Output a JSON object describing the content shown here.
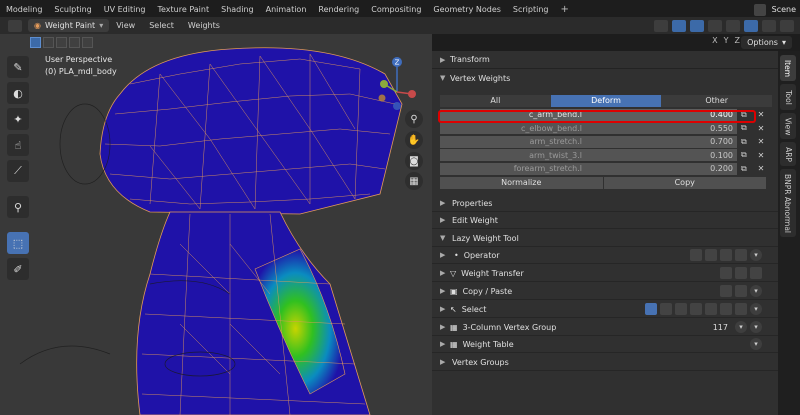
{
  "workspace_tabs": [
    "Modeling",
    "Sculpting",
    "UV Editing",
    "Texture Paint",
    "Shading",
    "Animation",
    "Rendering",
    "Compositing",
    "Geometry Nodes",
    "Scripting"
  ],
  "add_tab": "+",
  "scene_name": "Scene",
  "mode": "Weight Paint",
  "menus": [
    "View",
    "Select",
    "Weights"
  ],
  "axes": [
    "X",
    "Y",
    "Z"
  ],
  "options_label": "Options",
  "viewport": {
    "perspective": "User Perspective",
    "object": "(0) PLA_mdl_body"
  },
  "gizmo_axis": "Z",
  "panel": {
    "transform_label": "Transform",
    "vertex_weights_label": "Vertex Weights",
    "tabs": [
      "All",
      "Deform",
      "Other"
    ],
    "active_tab": "Deform",
    "weights": [
      {
        "name": "c_arm_bend.l",
        "value": "0.400",
        "active": true
      },
      {
        "name": "c_elbow_bend.l",
        "value": "0.550",
        "active": false
      },
      {
        "name": "arm_stretch.l",
        "value": "0.700",
        "active": false
      },
      {
        "name": "arm_twist_3.l",
        "value": "0.100",
        "active": false
      },
      {
        "name": "forearm_stretch.l",
        "value": "0.200",
        "active": false
      }
    ],
    "normalize_label": "Normalize",
    "copy_label": "Copy",
    "sections": {
      "properties": "Properties",
      "edit_weight": "Edit Weight",
      "lazy_weight_tool": "Lazy Weight Tool",
      "operator": "Operator",
      "weight_transfer": "Weight Transfer",
      "copy_paste": "Copy / Paste",
      "select": "Select",
      "three_col_vg": "3-Column Vertex Group",
      "three_col_count": "117",
      "weight_table": "Weight Table",
      "vertex_groups": "Vertex Groups"
    }
  },
  "side_tabs": [
    "Item",
    "Tool",
    "View",
    "ARP",
    "BNPR Abnormal"
  ],
  "colors": {
    "accent": "#4772b3",
    "highlight": "#dd0000",
    "mesh_blue": "#1f12a8",
    "wire": "#e39a5a"
  }
}
